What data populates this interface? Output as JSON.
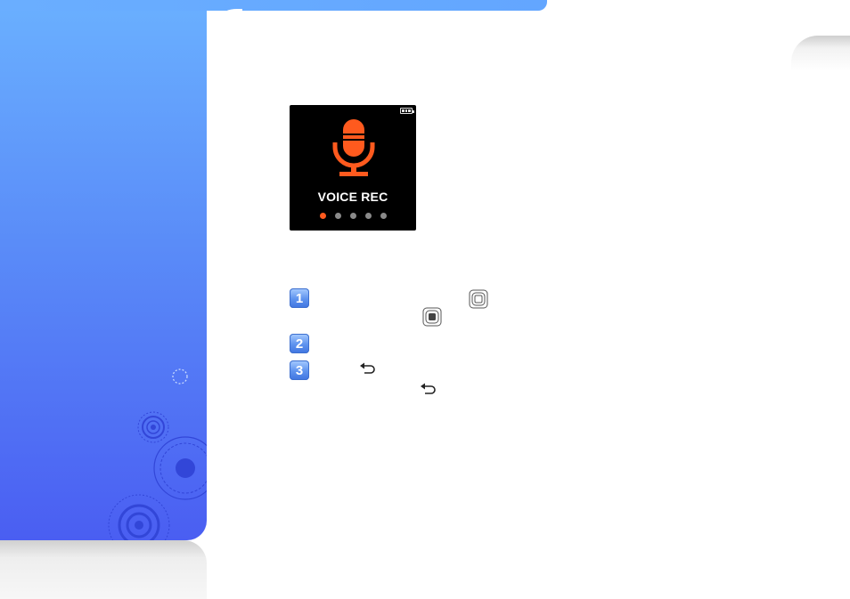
{
  "page": {
    "accent_gradient": [
      "#6ab0ff",
      "#4a5ef2"
    ],
    "tab_color": "#e6e6e6"
  },
  "device_screen": {
    "battery_icon": "battery-icon",
    "main_icon": "microphone-icon",
    "main_icon_color": "#ff5a1e",
    "label": "VOICE REC",
    "dots": {
      "count": 5,
      "active_index": 0,
      "active_color": "#ff5a1e"
    }
  },
  "steps": [
    {
      "number": "1",
      "icons": [
        "select-button-icon",
        "select-button-filled-icon"
      ]
    },
    {
      "number": "2",
      "icons": []
    },
    {
      "number": "3",
      "icons": [
        "back-icon",
        "back-icon"
      ]
    }
  ]
}
